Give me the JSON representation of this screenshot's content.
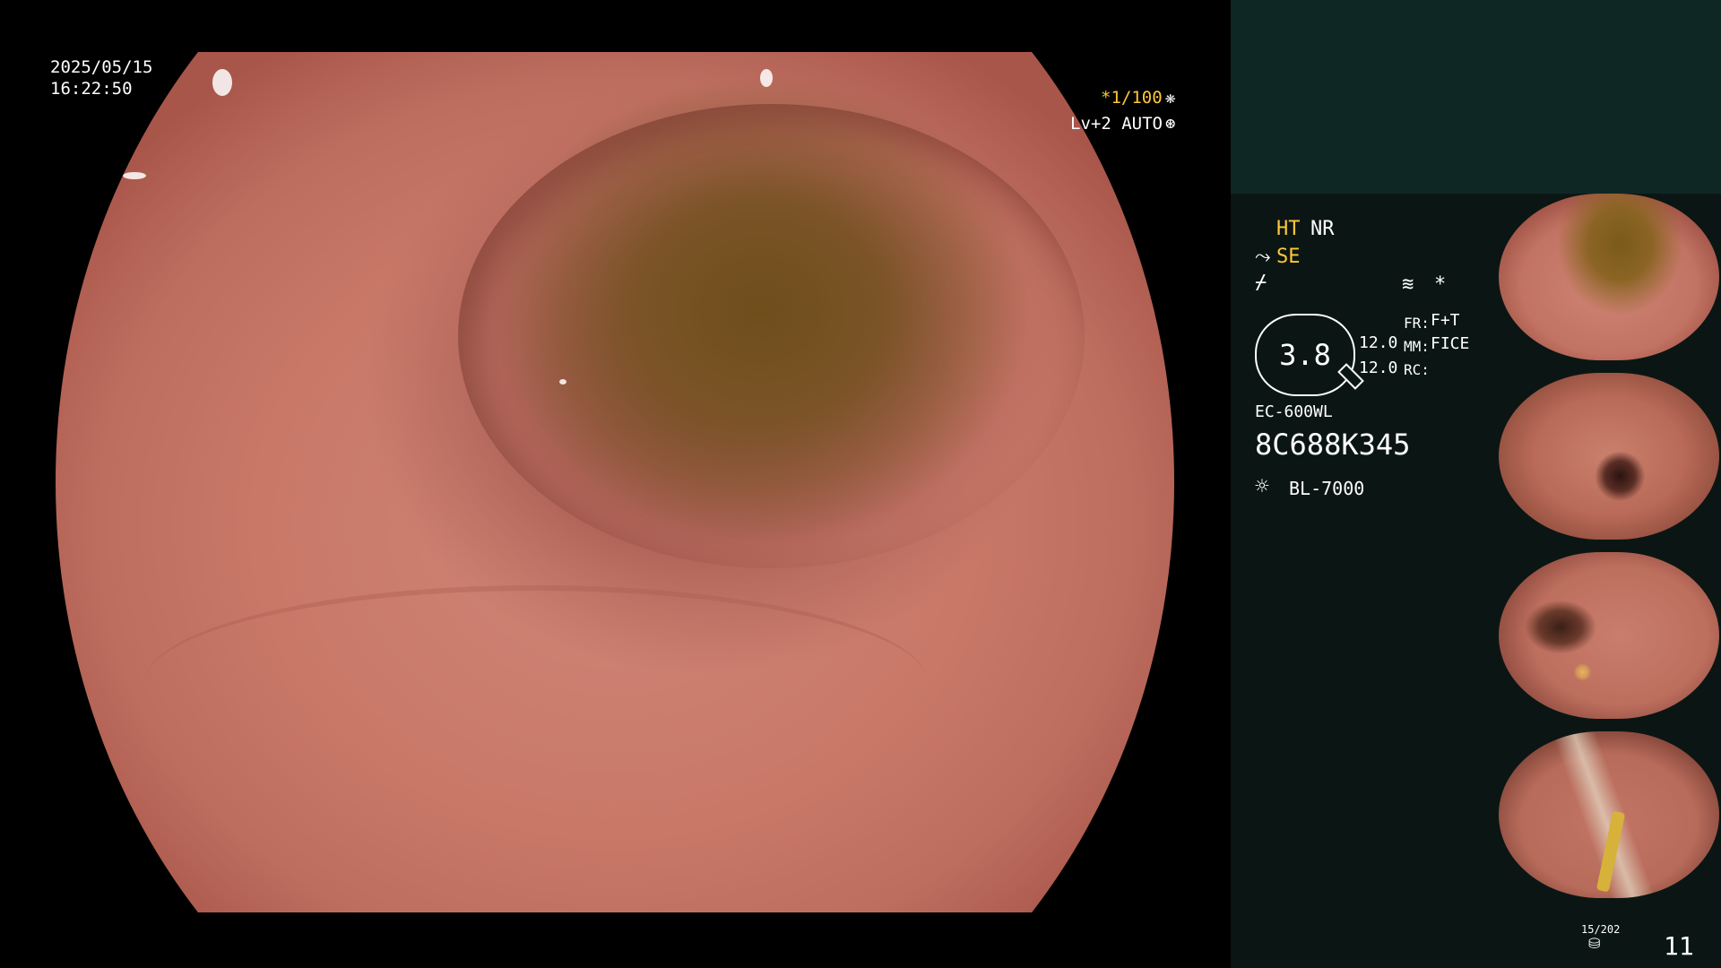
{
  "overlay": {
    "date": "2025/05/15",
    "time": "16:22:50",
    "shutter": "*1/100",
    "shutter_icon": "iris-icon",
    "level": "Lv+2 AUTO",
    "level_icon": "aperture-icon"
  },
  "info_panel": {
    "ht": "HT",
    "nr": "NR",
    "se": "SE",
    "se_icon": "enhance-icon",
    "slash_icon": "contrast-icon",
    "wave_icon": "structure-icon",
    "star": "*",
    "zoom_value": "3.8",
    "values": [
      "12.0",
      "12.0"
    ],
    "fr_label": "FR:",
    "fr_value": "F+T",
    "mm_label": "MM:",
    "mm_value": "FICE",
    "rc_label": "RC:",
    "scope_model": "EC-600WL",
    "serial": "8C688K345",
    "light_source": "BL-7000",
    "light_icon": "lamp-icon"
  },
  "footer": {
    "capture_count": "15/202",
    "storage_icon": "disk-icon",
    "page_number": "11"
  },
  "colors": {
    "accent_yellow": "#ffc83a",
    "panel_bg": "#0b1614",
    "panel_top": "#0f2724"
  },
  "thumbnails": [
    {
      "name": "thumbnail-1"
    },
    {
      "name": "thumbnail-2"
    },
    {
      "name": "thumbnail-3"
    },
    {
      "name": "thumbnail-4"
    }
  ]
}
